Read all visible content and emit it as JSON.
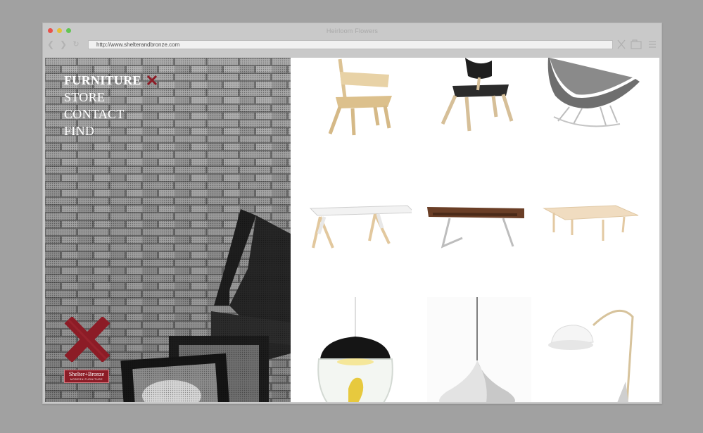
{
  "browser": {
    "window_title": "Heirloom Flowers",
    "url": "http://www.shelterandbronze.com",
    "icons": [
      "back-icon",
      "forward-icon",
      "reload-icon",
      "close-icon",
      "tabs-icon",
      "menu-icon"
    ]
  },
  "sidebar": {
    "menu": [
      {
        "label": "FURNITURE",
        "active": true
      },
      {
        "label": "STORE",
        "active": false
      },
      {
        "label": "CONTACT",
        "active": false
      },
      {
        "label": "FIND",
        "active": false
      }
    ],
    "brand": {
      "name": "Shelter+Bronze",
      "tagline": "MODERN FURNITURE"
    }
  },
  "products": [
    {
      "kind": "chair",
      "name": "wooden-chair"
    },
    {
      "kind": "chair",
      "name": "leather-wood-chair"
    },
    {
      "kind": "rocker",
      "name": "grey-rocking-chair"
    },
    {
      "kind": "table",
      "name": "white-trestle-table"
    },
    {
      "kind": "desk",
      "name": "walnut-desk"
    },
    {
      "kind": "table",
      "name": "oak-dining-table"
    },
    {
      "kind": "lamp",
      "name": "black-glass-pendant-lamp"
    },
    {
      "kind": "lamp",
      "name": "white-pendant-lamp"
    },
    {
      "kind": "lamp",
      "name": "white-floor-lamp"
    }
  ],
  "colors": {
    "accent": "#8c1c26",
    "chrome": "#c9c9c9",
    "backdrop": "#a1a1a1"
  }
}
